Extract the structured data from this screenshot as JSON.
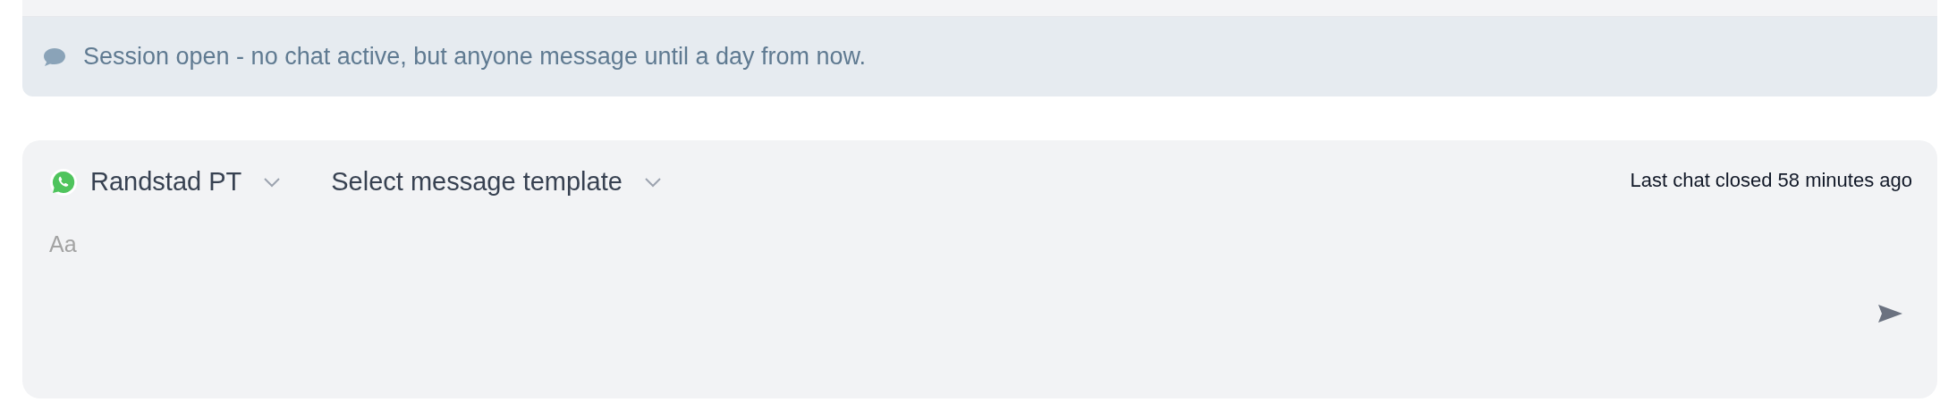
{
  "banner": {
    "text": "Session open - no chat active, but anyone message until a day from now."
  },
  "composer": {
    "channel": "Randstad PT",
    "template": "Select message template",
    "last_chat": "Last chat closed 58 minutes ago",
    "placeholder": "Aa"
  }
}
